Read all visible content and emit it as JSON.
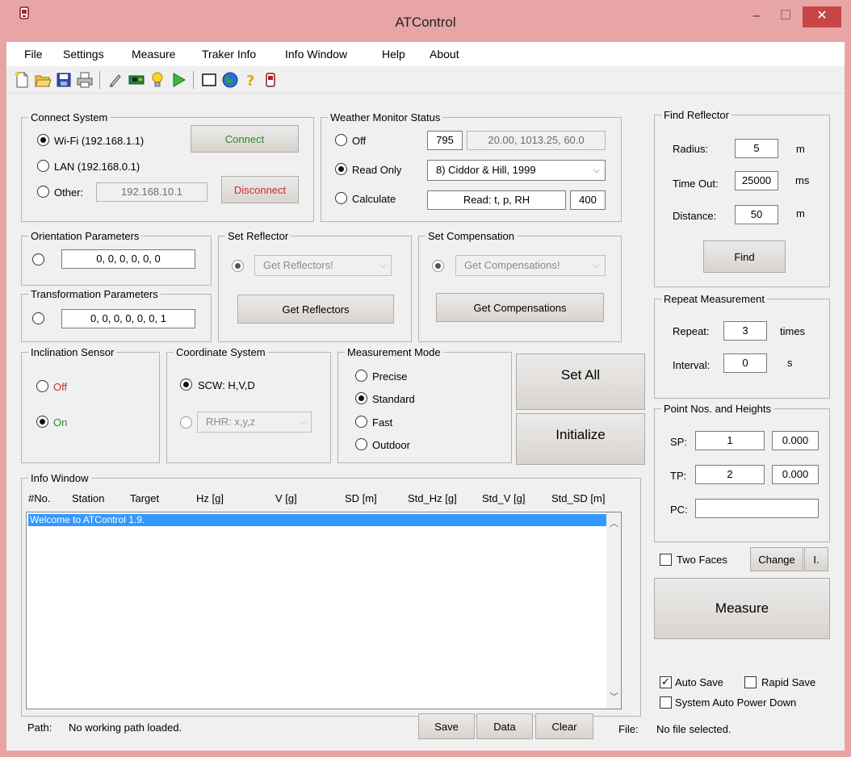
{
  "window": {
    "title": "ATControl",
    "minimize_glyph": "–",
    "maximize_glyph": "☐",
    "close_glyph": "✕"
  },
  "menu": [
    "File",
    "Settings",
    "Measure",
    "Traker Info",
    "Info Window",
    "Help",
    "About"
  ],
  "toolbar_icons": [
    "new-file-icon",
    "open-folder-icon",
    "save-disk-icon",
    "print-icon",
    "pen-icon",
    "circuit-board-icon",
    "lightbulb-icon",
    "play-icon",
    "rectangle-icon",
    "globe-icon",
    "help-question-icon",
    "tracker-device-icon"
  ],
  "connect_system": {
    "label": "Connect System",
    "wifi": "Wi-Fi (192.168.1.1)",
    "lan": "LAN (192.168.0.1)",
    "other": "Other:",
    "other_ip": "192.168.10.1",
    "connect": "Connect",
    "disconnect": "Disconnect"
  },
  "weather": {
    "label": "Weather Monitor Status",
    "off": "Off",
    "read_only": "Read Only",
    "calculate": "Calculate",
    "value": "795",
    "readout": "20.00, 1013.25, 60.0",
    "model": "8)  Ciddor & Hill, 1999",
    "read_text": "Read: t, p, RH",
    "read_value": "400"
  },
  "orientation": {
    "label": "Orientation Parameters",
    "value": "0, 0, 0, 0, 0, 0"
  },
  "transformation": {
    "label": "Transformation Parameters",
    "value": "0, 0, 0, 0, 0, 0, 1"
  },
  "set_reflector": {
    "label": "Set Reflector",
    "combo": "Get Reflectors!",
    "button": "Get Reflectors"
  },
  "set_compensation": {
    "label": "Set Compensation",
    "combo": "Get Compensations!",
    "button": "Get Compensations"
  },
  "inclination": {
    "label": "Inclination Sensor",
    "off": "Off",
    "on": "On"
  },
  "coordinate": {
    "label": "Coordinate System",
    "scw": "SCW: H,V,D",
    "rhr": "RHR:  x,y,z"
  },
  "measurement_mode": {
    "label": "Measurement Mode",
    "precise": "Precise",
    "standard": "Standard",
    "fast": "Fast",
    "outdoor": "Outdoor"
  },
  "buttons": {
    "set_all": "Set All",
    "initialize": "Initialize",
    "measure": "Measure",
    "change": "Change",
    "i": "I.",
    "find": "Find",
    "save": "Save",
    "data": "Data",
    "clear": "Clear"
  },
  "find_reflector": {
    "label": "Find Reflector",
    "radius_label": "Radius:",
    "radius": "5",
    "radius_unit": "m",
    "timeout_label": "Time Out:",
    "timeout": "25000",
    "timeout_unit": "ms",
    "distance_label": "Distance:",
    "distance": "50",
    "distance_unit": "m"
  },
  "repeat": {
    "label": "Repeat Measurement",
    "repeat_label": "Repeat:",
    "repeat": "3",
    "repeat_unit": "times",
    "interval_label": "Interval:",
    "interval": "0",
    "interval_unit": "s"
  },
  "points": {
    "label": "Point Nos. and Heights",
    "sp_label": "SP:",
    "sp": "1",
    "sp_h": "0.000",
    "tp_label": "TP:",
    "tp": "2",
    "tp_h": "0.000",
    "pc_label": "PC:",
    "pc": ""
  },
  "options": {
    "two_faces": "Two Faces",
    "auto_save": "Auto Save",
    "rapid_save": "Rapid Save",
    "auto_power_down": "System Auto Power Down"
  },
  "info_window": {
    "label": "Info Window",
    "columns": [
      "#No.",
      "Station",
      "Target",
      "Hz [g]",
      "V [g]",
      "SD [m]",
      "Std_Hz [g]",
      "Std_V [g]",
      "Std_SD [m]"
    ],
    "rows": [
      "Welcome to ATControl 1.9."
    ]
  },
  "status": {
    "path_label": "Path:",
    "path_value": "No working path loaded.",
    "file_label": "File:",
    "file_value": "No file selected."
  }
}
